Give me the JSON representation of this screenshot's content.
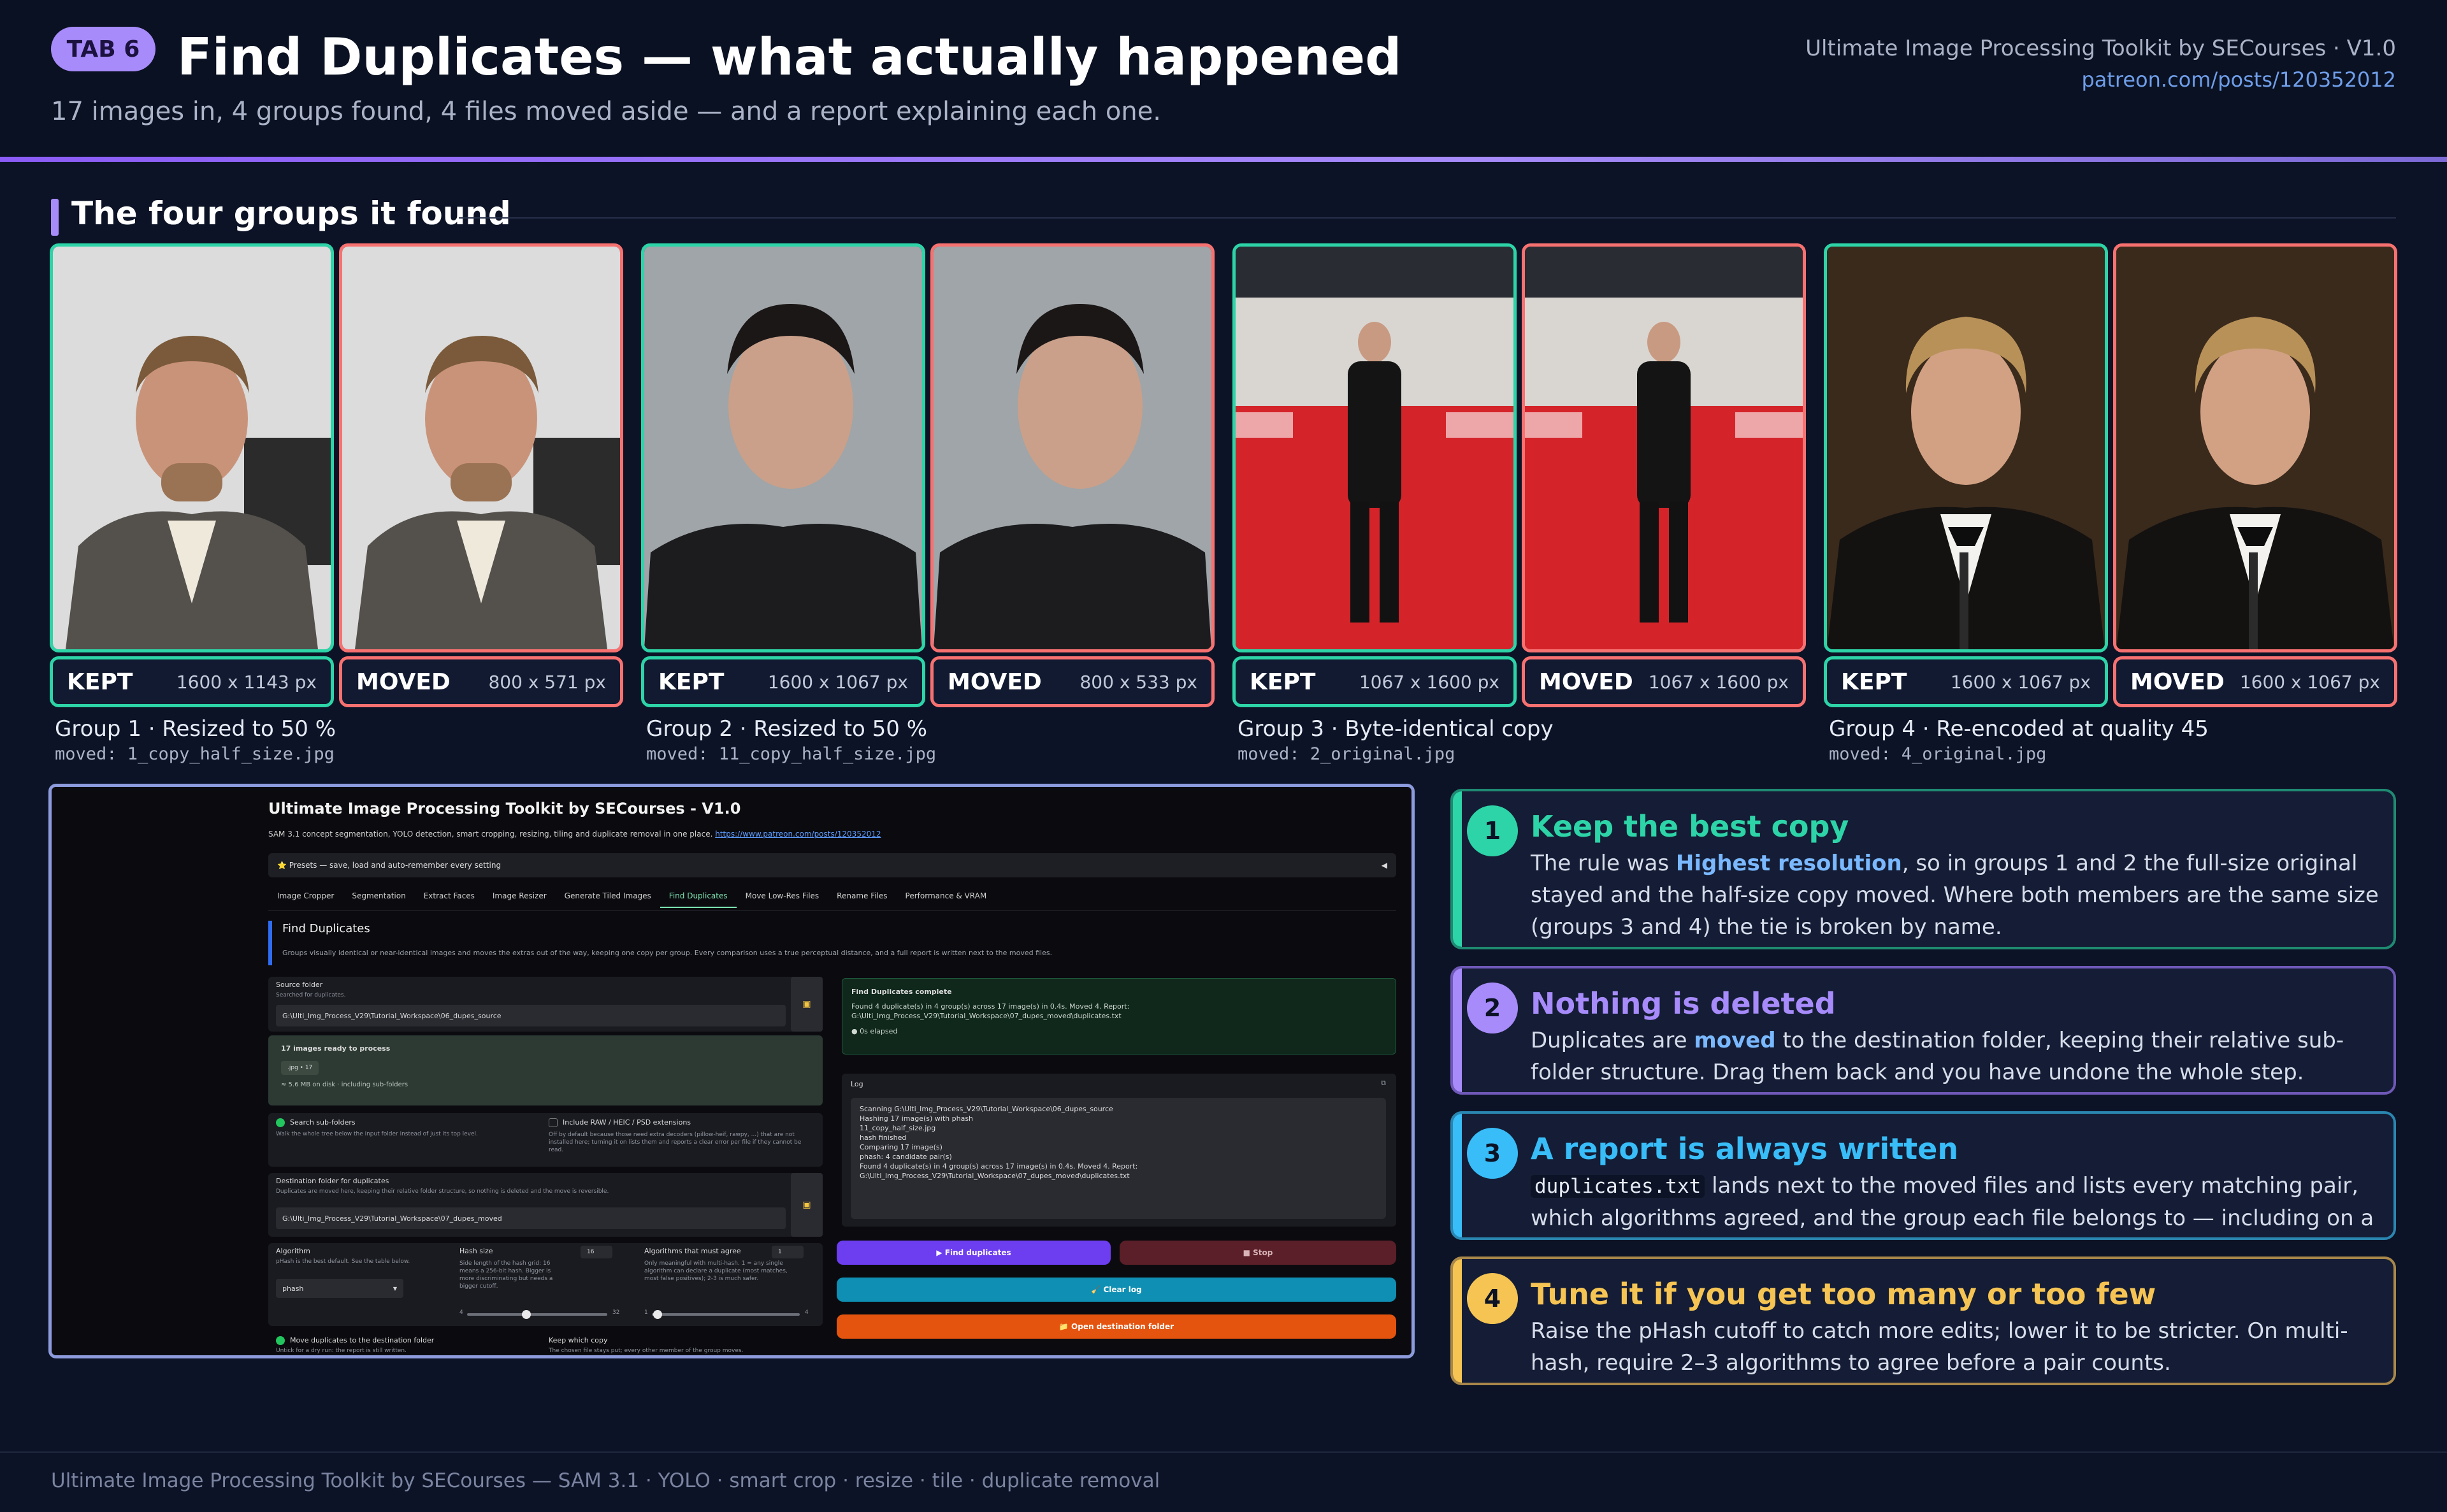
{
  "header": {
    "tab_badge": "TAB 6",
    "title": "Find Duplicates — what actually happened",
    "subtitle": "17 images in, 4 groups found, 4 files moved aside — and a report explaining each one.",
    "brand": "Ultimate Image Processing Toolkit by SECourses  ·  V1.0",
    "link": "patreon.com/posts/120352012"
  },
  "section": {
    "title": "The four groups it found"
  },
  "groups": [
    {
      "caption": "Group 1 · Resized to 50 %",
      "moved_file": "moved: 1_copy_half_size.jpg",
      "kept": {
        "label": "KEPT",
        "dims": "1600 x 1143 px"
      },
      "moved": {
        "label": "MOVED",
        "dims": "800 x 571 px"
      }
    },
    {
      "caption": "Group 2 · Resized to 50 %",
      "moved_file": "moved: 11_copy_half_size.jpg",
      "kept": {
        "label": "KEPT",
        "dims": "1600 x 1067 px"
      },
      "moved": {
        "label": "MOVED",
        "dims": "800 x 533 px"
      }
    },
    {
      "caption": "Group 3 · Byte-identical copy",
      "moved_file": "moved: 2_original.jpg",
      "kept": {
        "label": "KEPT",
        "dims": "1067 x 1600 px"
      },
      "moved": {
        "label": "MOVED",
        "dims": "1067 x 1600 px"
      }
    },
    {
      "caption": "Group 4 · Re-encoded at quality 45",
      "moved_file": "moved: 4_original.jpg",
      "kept": {
        "label": "KEPT",
        "dims": "1600 x 1067 px"
      },
      "moved": {
        "label": "MOVED",
        "dims": "1600 x 1067 px"
      }
    }
  ],
  "app": {
    "title": "Ultimate Image Processing Toolkit by SECourses - V1.0",
    "desc": "SAM 3.1 concept segmentation, YOLO detection, smart cropping, resizing, tiling and duplicate removal in one place.",
    "desc_link": "https://www.patreon.com/posts/120352012",
    "presets": "⭐ Presets — save, load and auto-remember every setting",
    "presets_arrow": "◀",
    "tabs": [
      "Image Cropper",
      "Segmentation",
      "Extract Faces",
      "Image Resizer",
      "Generate Tiled Images",
      "Find Duplicates",
      "Move Low-Res Files",
      "Rename Files",
      "Performance & VRAM"
    ],
    "section_title": "Find Duplicates",
    "section_desc": "Groups visually identical or near-identical images and moves the extras out of the way, keeping one copy per group. Every comparison uses a true perceptual distance, and a full report is written next to the moved files.",
    "source_label": "Source folder",
    "source_sub": "Searched for duplicates.",
    "source_value": "G:\\Ulti_Img_Process_V29\\Tutorial_Workspace\\06_dupes_source",
    "ready_title": "17 images ready to process",
    "ready_chip": ".jpg • 17",
    "ready_size": "≈ 5.6 MB on disk · including sub-folders",
    "search_sub_label": "Search sub-folders",
    "search_sub_desc": "Walk the whole tree below the input folder instead of just its top level.",
    "include_raw_label": "Include RAW / HEIC / PSD extensions",
    "include_raw_desc": "Off by default because those need extra decoders (pillow-heif, rawpy, ...) that are not installed here; turning it on lists them and reports a clear error per file if they cannot be read.",
    "dest_label": "Destination folder for duplicates",
    "dest_sub": "Duplicates are moved here, keeping their relative folder structure, so nothing is deleted and the move is reversible.",
    "dest_value": "G:\\Ulti_Img_Process_V29\\Tutorial_Workspace\\07_dupes_moved",
    "algo_label": "Algorithm",
    "algo_sub": "pHash is the best default. See the table below.",
    "algo_value": "phash",
    "hash_label": "Hash size",
    "hash_value": "16",
    "hash_desc": "Side length of the hash grid: 16 means a 256-bit hash. Bigger is more discriminating but needs a bigger cutoff.",
    "hash_min": "4",
    "hash_max": "32",
    "agree_label": "Algorithms that must agree",
    "agree_value": "1",
    "agree_desc": "Only meaningful with multi-hash. 1 = any single algorithm can declare a duplicate (most matches, most false positives); 2-3 is much safer.",
    "agree_min": "1",
    "agree_max": "4",
    "move_label": "Move duplicates to the destination folder",
    "move_sub": "Untick for a dry run: the report is still written.",
    "keep_label": "Keep which copy",
    "keep_sub": "The chosen file stays put; every other member of the group moves.",
    "complete_title": "Find Duplicates complete",
    "complete_text": "Found 4 duplicate(s) in 4 group(s) across 17 image(s) in 0.4s. Moved 4. Report: G:\\Ulti_Img_Process_V29\\Tutorial_Workspace\\07_dupes_moved\\duplicates.txt",
    "complete_elapsed": "0s elapsed",
    "log_label": "Log",
    "log_lines": [
      "Scanning G:\\Ulti_Img_Process_V29\\Tutorial_Workspace\\06_dupes_source",
      "Hashing 17 image(s) with phash",
      "11_copy_half_size.jpg",
      "hash finished",
      "Comparing 17 image(s)",
      "phash: 4 candidate pair(s)",
      "Found 4 duplicate(s) in 4 group(s) across 17 image(s) in 0.4s. Moved 4. Report:",
      "G:\\Ulti_Img_Process_V29\\Tutorial_Workspace\\07_dupes_moved\\duplicates.txt"
    ],
    "btn_find": "▶ Find duplicates",
    "btn_stop": "■ Stop",
    "btn_clear": "🧹 Clear log",
    "btn_open": "📁 Open destination folder"
  },
  "tips": [
    {
      "num": "1",
      "title": "Keep the best copy",
      "pre": "The rule was ",
      "em": "Highest resolution",
      "post": ", so in groups 1 and 2 the full-size original stayed and the half-size copy moved. Where both members are the same size (groups 3 and 4) the tie is broken by name.",
      "color": "#2dd4a7"
    },
    {
      "num": "2",
      "title": "Nothing is deleted",
      "pre": "Duplicates are ",
      "em": "moved",
      "post": " to the destination folder, keeping their relative sub-folder structure. Drag them back and you have undone the whole step.",
      "color": "#a78bfa"
    },
    {
      "num": "3",
      "title": "A report is always written",
      "code": "duplicates.txt",
      "post": " lands next to the moved files and lists every matching pair, which algorithms agreed, and the group each file belongs to — including on a dry run.",
      "color": "#38bdf8"
    },
    {
      "num": "4",
      "title": "Tune it if you get too many or too few",
      "body": "Raise the pHash cutoff to catch more edits; lower it to be stricter. On multi-hash, require 2–3 algorithms to agree before a pair counts.",
      "color": "#f6c453"
    }
  ],
  "footer": "Ultimate Image Processing Toolkit by SECourses — SAM 3.1 · YOLO · smart crop · resize · tile · duplicate removal"
}
